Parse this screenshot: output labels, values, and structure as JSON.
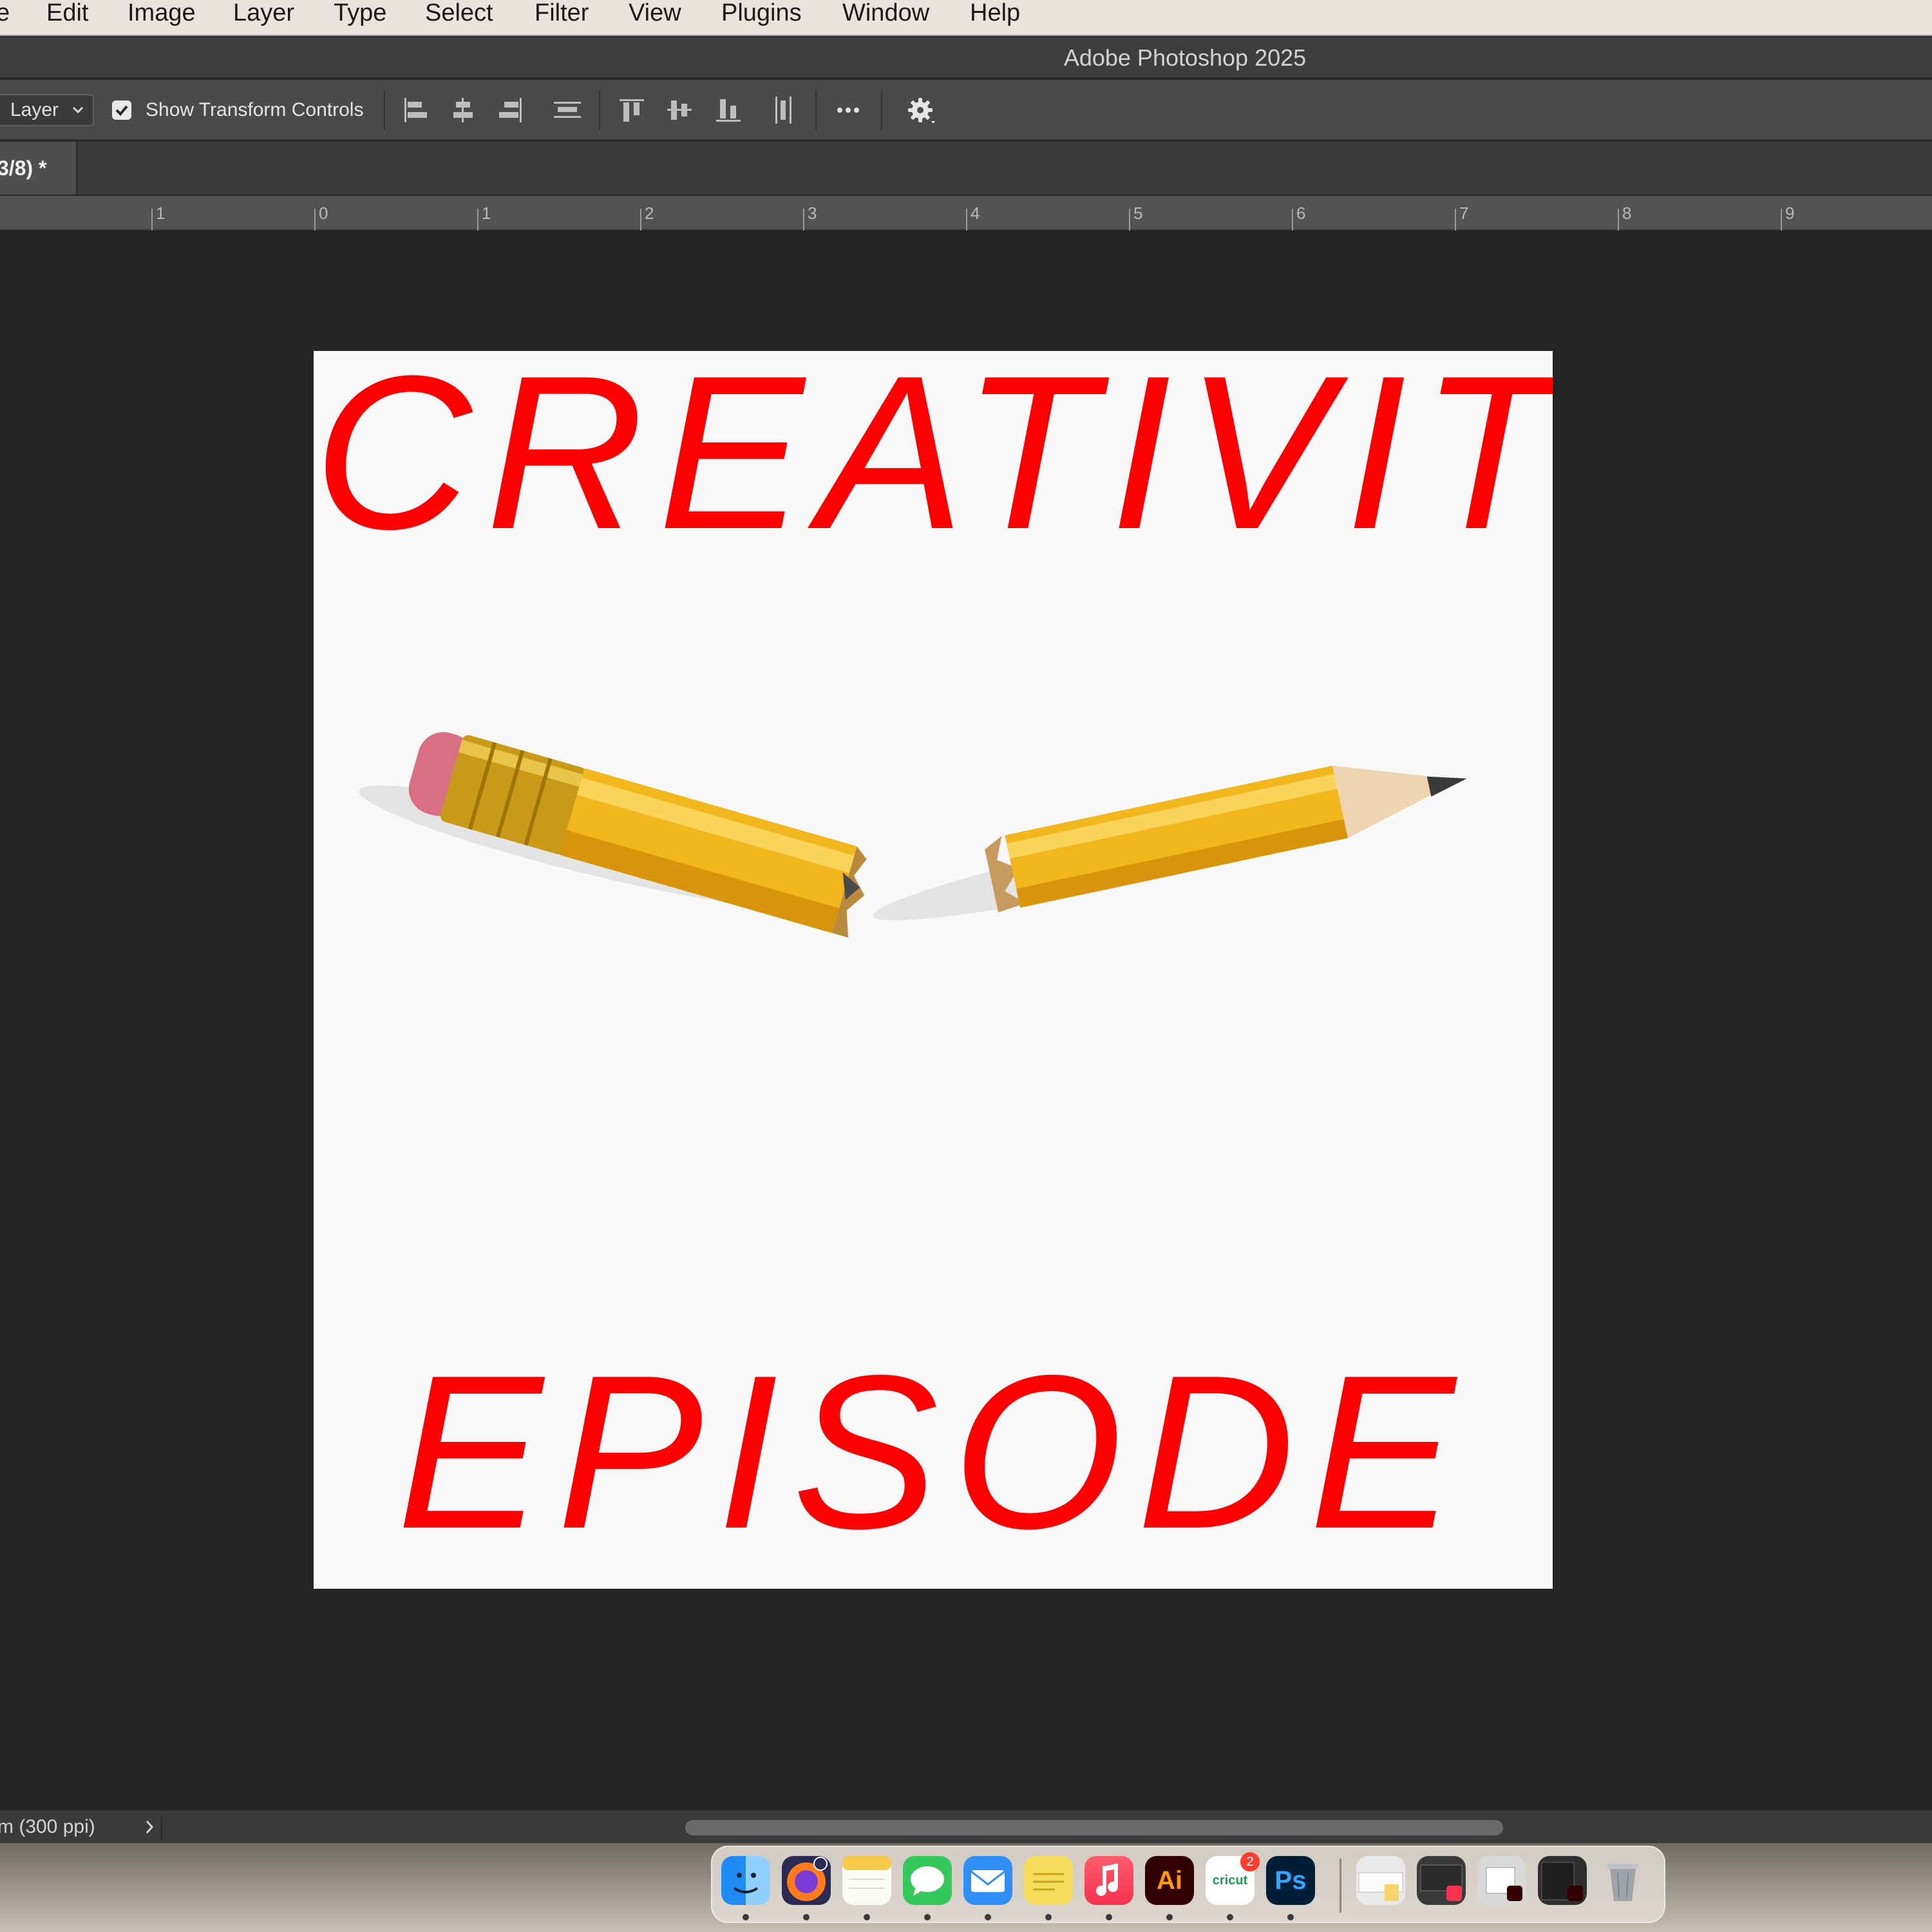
{
  "menubar": {
    "items": [
      "e",
      "Edit",
      "Image",
      "Layer",
      "Type",
      "Select",
      "Filter",
      "View",
      "Plugins",
      "Window",
      "Help"
    ]
  },
  "titlebar": {
    "title": "Adobe Photoshop 2025"
  },
  "options": {
    "auto_select_target": "Layer",
    "show_transform_controls": {
      "label": "Show Transform Controls",
      "checked": true
    },
    "icons": [
      "align-left-icon",
      "align-horizontal-center-icon",
      "align-right-icon",
      "distribute-horizontal-icon",
      "align-top-icon",
      "align-vertical-center-icon",
      "align-bottom-icon",
      "distribute-vertical-icon",
      "more-options-icon",
      "gear-icon"
    ]
  },
  "document_tab": {
    "label": "3/8) *"
  },
  "ruler": {
    "labels": [
      "1",
      "0",
      "1",
      "2",
      "3",
      "4",
      "5",
      "6",
      "7",
      "8",
      "9"
    ]
  },
  "artwork": {
    "headline_top": "CREATIVITY",
    "headline_bottom": "EPISODE",
    "text_color": "#ff0000",
    "background": "#f8f8f8"
  },
  "status": {
    "zoom_info": "m (300 ppi)"
  },
  "dock": {
    "apps": [
      "Finder",
      "Firefox",
      "Notes",
      "Messages",
      "Mail",
      "Stickies",
      "Music",
      "Illustrator",
      "Cricut Design Space",
      "Photoshop"
    ],
    "illustrator_label": "Ai",
    "photoshop_label": "Ps",
    "cricut_label": "cricut",
    "cricut_badge": "2",
    "recent_windows": [
      "window-thumbnail-1",
      "window-thumbnail-2",
      "window-thumbnail-3",
      "window-thumbnail-4"
    ],
    "trash": "Trash"
  }
}
